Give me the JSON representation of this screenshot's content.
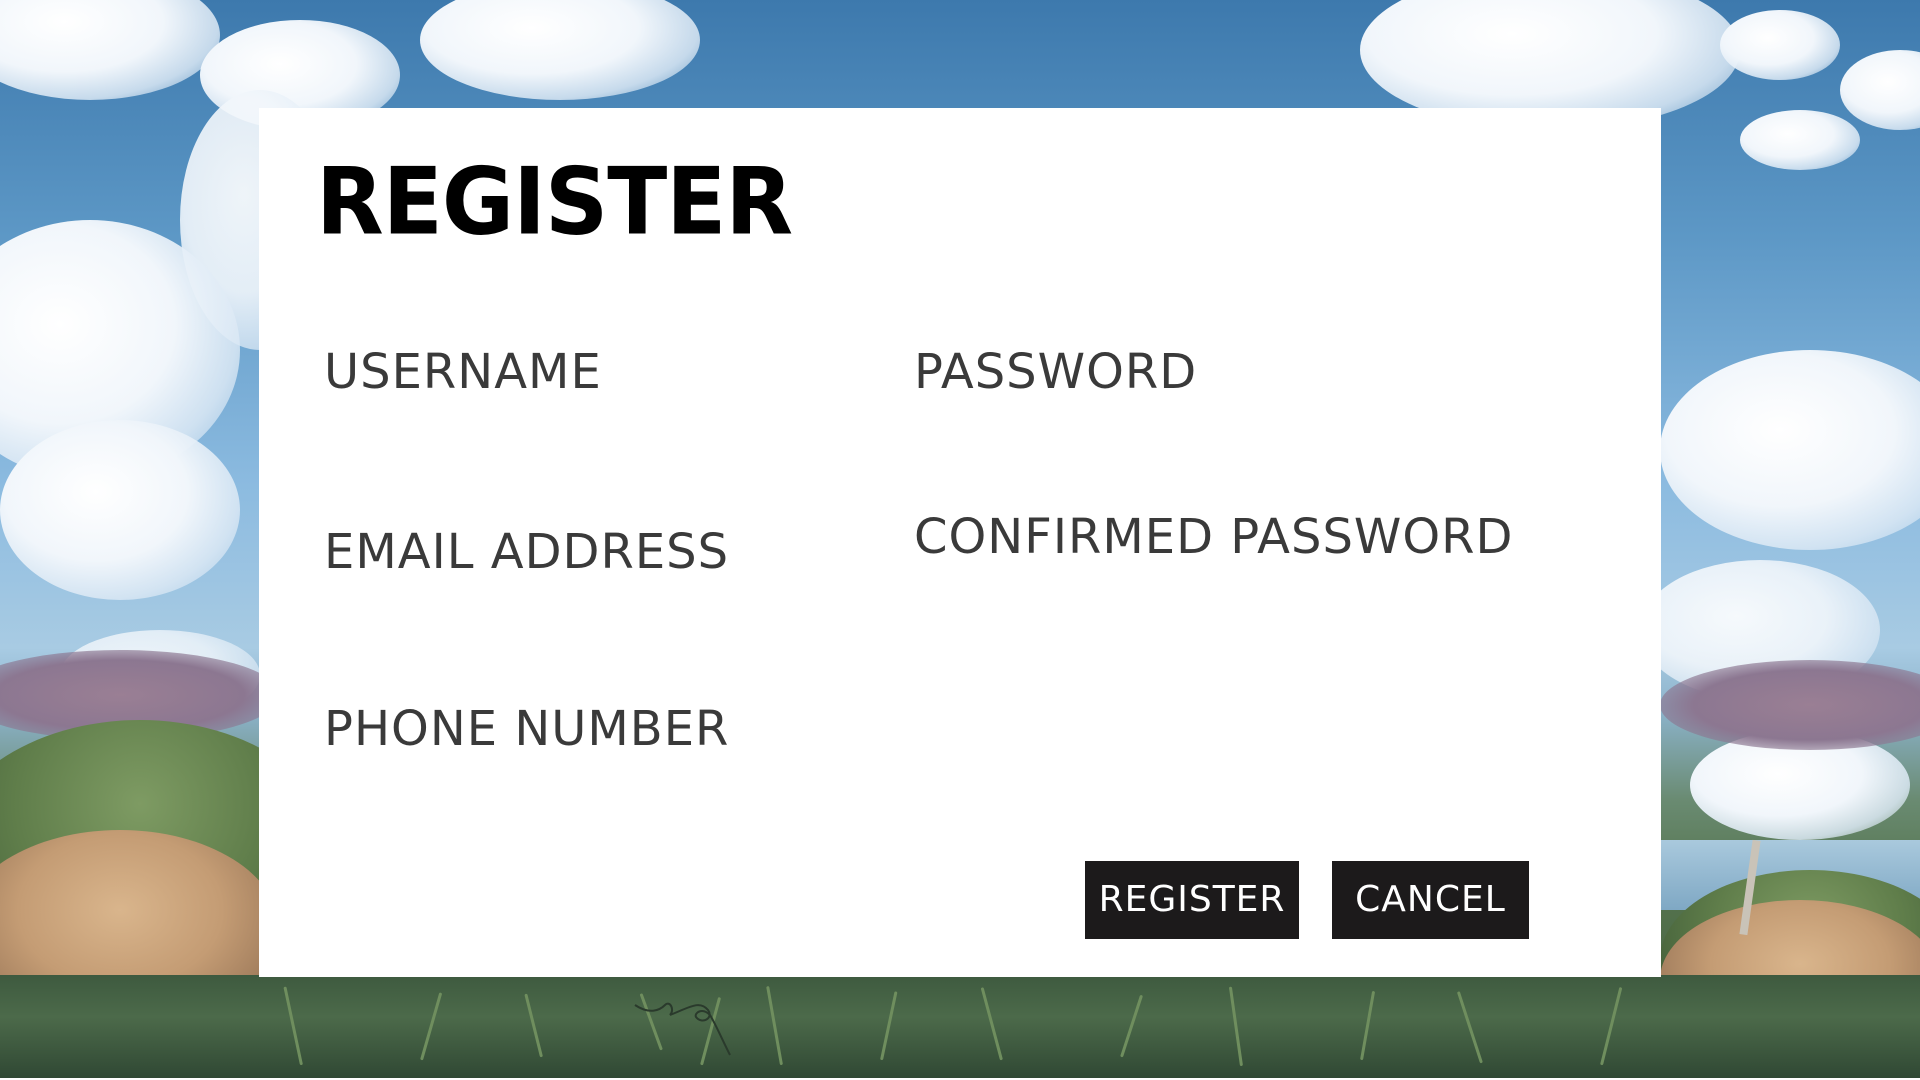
{
  "form": {
    "title": "REGISTER",
    "fields": {
      "username": {
        "label": "USERNAME",
        "value": ""
      },
      "password": {
        "label": "PASSWORD",
        "value": ""
      },
      "email": {
        "label": "EMAIL ADDRESS",
        "value": ""
      },
      "confirm_password": {
        "label": "CONFIRMED PASSWORD",
        "value": ""
      },
      "phone": {
        "label": "PHONE NUMBER",
        "value": ""
      }
    },
    "buttons": {
      "register_label": "REGISTER",
      "cancel_label": "CANCEL"
    }
  },
  "background": {
    "description_icon": "landscape-background",
    "colors": {
      "panel": "#ffffff",
      "button_bg": "#1c1a1b",
      "button_text": "#ffffff",
      "title": "#000000",
      "label": "#3a3a3a"
    }
  }
}
